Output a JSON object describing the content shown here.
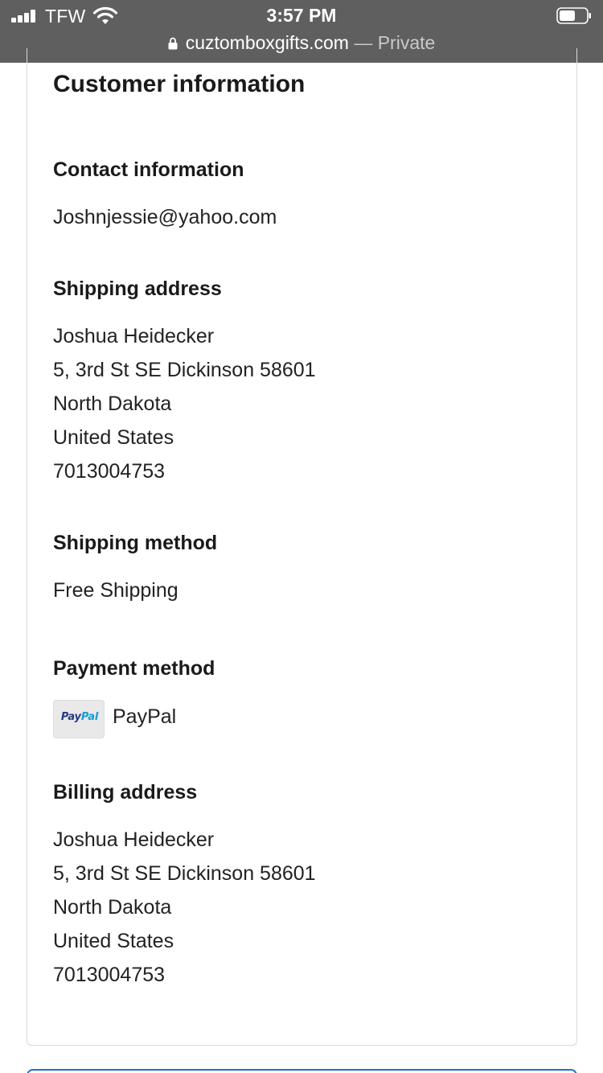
{
  "status_bar": {
    "carrier": "TFW",
    "time": "3:57 PM"
  },
  "address_bar": {
    "domain": "cuztomboxgifts.com",
    "separator": " — ",
    "mode": "Private"
  },
  "section": {
    "title": "Customer information"
  },
  "contact": {
    "heading": "Contact information",
    "email": "Joshnjessie@yahoo.com"
  },
  "shipping_address": {
    "heading": "Shipping address",
    "lines": [
      "Joshua Heidecker",
      "5, 3rd St SE Dickinson 58601",
      "North Dakota",
      "United States",
      "7013004753"
    ]
  },
  "shipping_method": {
    "heading": "Shipping method",
    "value": "Free Shipping"
  },
  "payment_method": {
    "heading": "Payment method",
    "logo_pay": "Pay",
    "logo_pal": "Pal",
    "label": "PayPal"
  },
  "billing_address": {
    "heading": "Billing address",
    "lines": [
      "Joshua Heidecker",
      "5, 3rd St SE Dickinson 58601",
      "North Dakota",
      "United States",
      "7013004753"
    ]
  },
  "colors": {
    "topbar": "#5f5f5f",
    "paypal_dark": "#253b80",
    "paypal_light": "#179bd7",
    "button_border": "#1a73c9"
  },
  "icons": {
    "signal": "cellular-signal-icon",
    "wifi": "wifi-icon",
    "battery": "battery-icon",
    "lock": "lock-icon"
  }
}
